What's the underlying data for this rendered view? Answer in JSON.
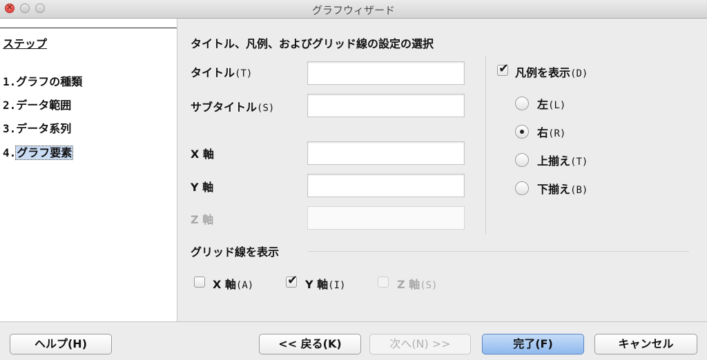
{
  "window": {
    "title": "グラフウィザード"
  },
  "sidebar": {
    "heading": "ステップ",
    "steps": [
      {
        "num": "1.",
        "label": "グラフの種類"
      },
      {
        "num": "2.",
        "label": "データ範囲"
      },
      {
        "num": "3.",
        "label": "データ系列"
      },
      {
        "num": "4.",
        "label": "グラフ要素"
      }
    ]
  },
  "main": {
    "section_title": "タイトル、凡例、およびグリッド線の設定の選択",
    "title_label": "タイトル",
    "title_key": "(T)",
    "title_value": "",
    "subtitle_label": "サブタイトル",
    "subtitle_key": "(S)",
    "subtitle_value": "",
    "x_axis_label": "X 軸",
    "x_axis_value": "",
    "y_axis_label": "Y 軸",
    "y_axis_value": "",
    "z_axis_label": "Z 軸",
    "z_axis_value": ""
  },
  "legend": {
    "show_label": "凡例を表示",
    "show_key": "(D)",
    "show_checked": true,
    "positions": [
      {
        "label": "左",
        "key": "(L)",
        "selected": false
      },
      {
        "label": "右",
        "key": "(R)",
        "selected": true
      },
      {
        "label": "上揃え",
        "key": "(T)",
        "selected": false
      },
      {
        "label": "下揃え",
        "key": "(B)",
        "selected": false
      }
    ]
  },
  "grid": {
    "title": "グリッド線を表示",
    "x": {
      "label": "X 軸",
      "key": "(A)",
      "checked": false
    },
    "y": {
      "label": "Y 軸",
      "key": "(I)",
      "checked": true
    },
    "z": {
      "label": "Z 軸",
      "key": "(S)",
      "checked": false,
      "disabled": true
    }
  },
  "buttons": {
    "help": "ヘルプ(H)",
    "back": "<< 戻る(K)",
    "next": "次へ(N) >>",
    "finish": "完了(F)",
    "cancel": "キャンセル"
  },
  "colors": {
    "default_button": "#8fb9ee",
    "selection": "#c9dcf4"
  }
}
